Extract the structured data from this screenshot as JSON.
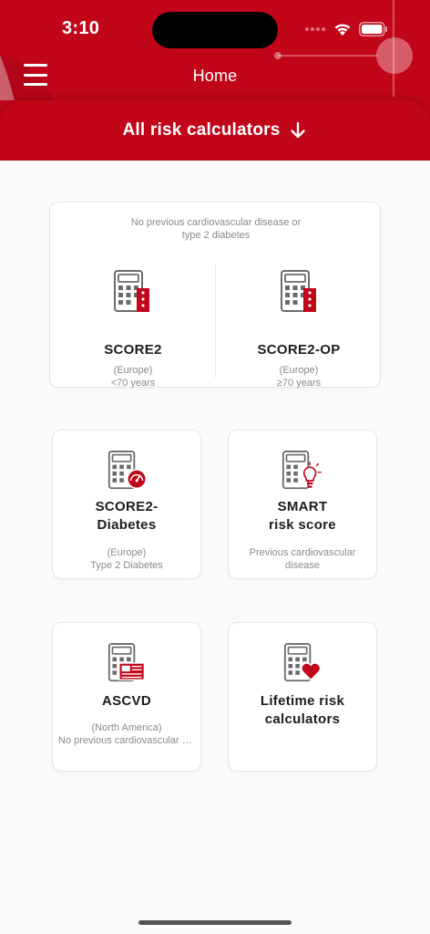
{
  "status_bar": {
    "time": "3:10"
  },
  "header": {
    "title": "Home",
    "menu_icon": "hamburger-menu-icon",
    "tab_label": "All risk calculators",
    "tab_icon": "arrow-down-icon"
  },
  "colors": {
    "brand_red": "#c10619",
    "text_dark": "#1d1d1f",
    "text_muted": "#8a8a8a",
    "icon_gray": "#6b6b6b"
  },
  "group": {
    "note": "No previous cardiovascular disease or type 2 diabetes",
    "note_line1": "No previous cardiovascular disease or",
    "note_line2": "type 2 diabetes",
    "items": [
      {
        "name": "SCORE2",
        "region": "(Europe)",
        "detail": "<70 years",
        "icon": "calculator-eu-flag-icon"
      },
      {
        "name": "SCORE2-OP",
        "region": "(Europe)",
        "detail": "≥70 years",
        "icon": "calculator-eu-flag-icon"
      }
    ]
  },
  "tiles": [
    {
      "name_line1": "SCORE2-",
      "name_line2": "Diabetes",
      "region": "(Europe)",
      "detail": "Type 2 Diabetes",
      "icon": "calculator-gauge-icon"
    },
    {
      "name_line1": "SMART",
      "name_line2": "risk score",
      "detail_line1": "Previous cardiovascular",
      "detail_line2": "disease",
      "icon": "calculator-lightbulb-icon"
    },
    {
      "name": "ASCVD",
      "region": "(North America)",
      "detail": "No previous cardiovascular d...",
      "icon": "calculator-flag-icon"
    },
    {
      "name_line1": "Lifetime risk",
      "name_line2": "calculators",
      "icon": "calculator-heart-icon"
    }
  ]
}
